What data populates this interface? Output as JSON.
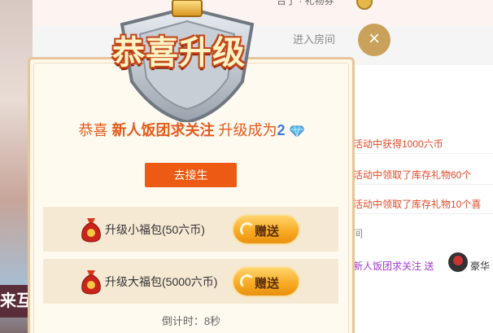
{
  "background": {
    "top_text": "台了 · 礼物券",
    "hint": "进入房间",
    "left_text": "来互动"
  },
  "chat": {
    "rows": [
      "活动中获得1000六币",
      "活动中领取了库存礼物60个",
      "活动中领取了库存礼物10个喜",
      "间",
      "新人饭团求关注 送",
      "豪华"
    ]
  },
  "modal": {
    "badge_title": "恭喜升级",
    "congrats_prefix": "恭喜 ",
    "username": "新人饭团求关注",
    "congrats_mid": " 升级成为",
    "level": "2",
    "action_label": "去接生",
    "gifts": [
      {
        "label": "升级小福包(50六币)",
        "send_label": "赠送"
      },
      {
        "label": "升级大福包(5000六币)",
        "send_label": "赠送"
      }
    ],
    "countdown": "倒计时：8秒"
  },
  "close_label": "×",
  "colors": {
    "accent_orange": "#ec5a14",
    "title_red": "#e35a1c",
    "level_blue": "#3a7ad8",
    "gold": "#c9a15a"
  },
  "icons": [
    "shield-badge-icon",
    "diamond-icon",
    "lucky-bag-icon",
    "close-icon",
    "coin-icon"
  ]
}
